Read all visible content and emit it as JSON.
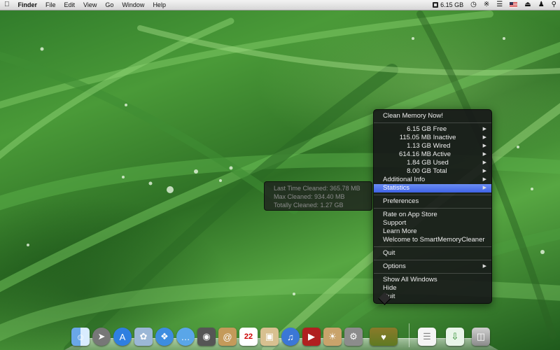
{
  "menubar": {
    "apple_icon": "apple-logo-icon",
    "items": [
      "Finder",
      "File",
      "Edit",
      "View",
      "Go",
      "Window",
      "Help"
    ],
    "status_memory": "6.15 GB",
    "status_icons": [
      "memory-chip-icon",
      "time-machine-icon",
      "bluetooth-icon",
      "wifi-icon",
      "us-flag-icon",
      "eject-icon",
      "user-icon",
      "spotlight-icon"
    ]
  },
  "menu": {
    "action": "Clean Memory Now!",
    "stats": [
      {
        "value": "6.15 GB",
        "label": "Free"
      },
      {
        "value": "115.05 MB",
        "label": "Inactive"
      },
      {
        "value": "1.13 GB",
        "label": "Wired"
      },
      {
        "value": "614.16 MB",
        "label": "Active"
      },
      {
        "value": "1.84 GB",
        "label": "Used"
      },
      {
        "value": "8.00 GB",
        "label": "Total"
      }
    ],
    "additional_info": "Additional Info",
    "statistics": "Statistics",
    "preferences": "Preferences",
    "rate": "Rate on App Store",
    "support": "Support",
    "learn_more": "Learn More",
    "welcome": "Welcome to SmartMemoryCleaner",
    "quit1": "Quit",
    "options": "Options",
    "show_all": "Show All Windows",
    "hide": "Hide",
    "quit2": "Quit"
  },
  "submenu": {
    "last_time": "Last Time Cleaned: 365.78 MB",
    "max": "Max Cleaned: 934.40 MB",
    "total": "Totally Cleaned: 1.27 GB"
  },
  "dock": {
    "apps": [
      "finder-icon",
      "rocket-launchpad-icon",
      "app-store-icon",
      "preview-bird-icon",
      "safari-icon",
      "ichat-icon",
      "facetime-icon",
      "address-book-icon",
      "calendar-icon",
      "photo-booth-icon",
      "itunes-icon",
      "dvd-player-icon",
      "iphoto-icon",
      "system-preferences-icon",
      "smart-memory-cleaner-icon",
      "documents-stack-icon",
      "downloads-stack-icon",
      "trash-icon"
    ],
    "calendar_day": "22"
  },
  "colors": {
    "menu_bg": "#161618",
    "selection": "#4a6cf0",
    "grass": "#3d8a30"
  }
}
